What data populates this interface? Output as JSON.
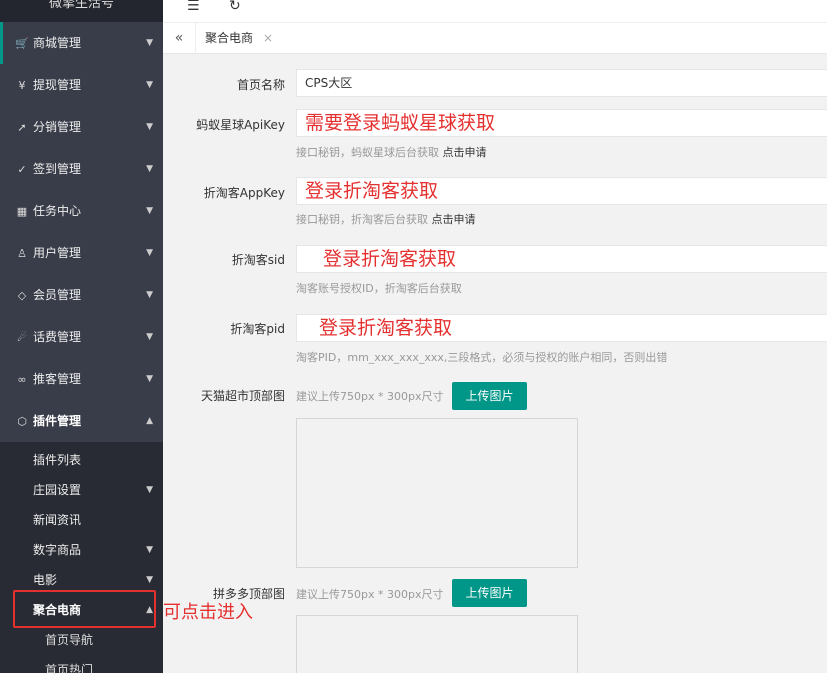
{
  "brand": "微擎生活号",
  "sidebar": {
    "items": [
      {
        "label": "商城管理",
        "icon": "cart-icon",
        "glyph": "🛒"
      },
      {
        "label": "提现管理",
        "icon": "yen-icon",
        "glyph": "¥"
      },
      {
        "label": "分销管理",
        "icon": "send-icon",
        "glyph": "➚"
      },
      {
        "label": "签到管理",
        "icon": "check-icon",
        "glyph": "✓"
      },
      {
        "label": "任务中心",
        "icon": "apps-icon",
        "glyph": "▦"
      },
      {
        "label": "用户管理",
        "icon": "user-icon",
        "glyph": "♙"
      },
      {
        "label": "会员管理",
        "icon": "diamond-icon",
        "glyph": "◇"
      },
      {
        "label": "话费管理",
        "icon": "fire-icon",
        "glyph": "☄"
      },
      {
        "label": "推客管理",
        "icon": "link-icon",
        "glyph": "∞"
      },
      {
        "label": "插件管理",
        "icon": "cube-icon",
        "glyph": "⬡"
      }
    ],
    "plugin_sub": [
      {
        "label": "插件列表"
      },
      {
        "label": "庄园设置"
      },
      {
        "label": "新闻资讯"
      },
      {
        "label": "数字商品"
      },
      {
        "label": "电影"
      },
      {
        "label": "聚合电商"
      }
    ],
    "juhe_sub": [
      {
        "label": "首页导航"
      },
      {
        "label": "首页热门"
      }
    ]
  },
  "tabs": [
    {
      "label": "聚合电商"
    }
  ],
  "form": {
    "home_name": {
      "label": "首页名称",
      "value": "CPS大区"
    },
    "ant_key": {
      "label": "蚂蚁星球ApiKey",
      "value": "需要登录蚂蚁星球获取",
      "hint": "接口秘钥，蚂蚁星球后台获取",
      "hint_link": "点击申请"
    },
    "ztk_appkey": {
      "label": "折淘客AppKey",
      "value": "登录折淘客获取",
      "hint": "接口秘钥，折淘客后台获取",
      "hint_link": "点击申请"
    },
    "ztk_sid": {
      "label": "折淘客sid",
      "value": "登录折淘客获取",
      "hint": "淘客账号授权ID，折淘客后台获取"
    },
    "ztk_pid": {
      "label": "折淘客pid",
      "value": "登录折淘客获取",
      "hint": "淘客PID，mm_xxx_xxx_xxx,三段格式，必须与授权的账户相同，否则出错"
    },
    "tmall_img": {
      "label": "天猫超市顶部图",
      "hint": "建议上传750px * 300px尺寸",
      "button": "上传图片"
    },
    "pdd_img": {
      "label": "拼多多顶部图",
      "hint": "建议上传750px * 300px尺寸",
      "button": "上传图片"
    }
  },
  "annotation": "可点击进入",
  "colors": {
    "accent": "#009688",
    "sidebar": "#393d49",
    "annotation": "#e53030"
  }
}
